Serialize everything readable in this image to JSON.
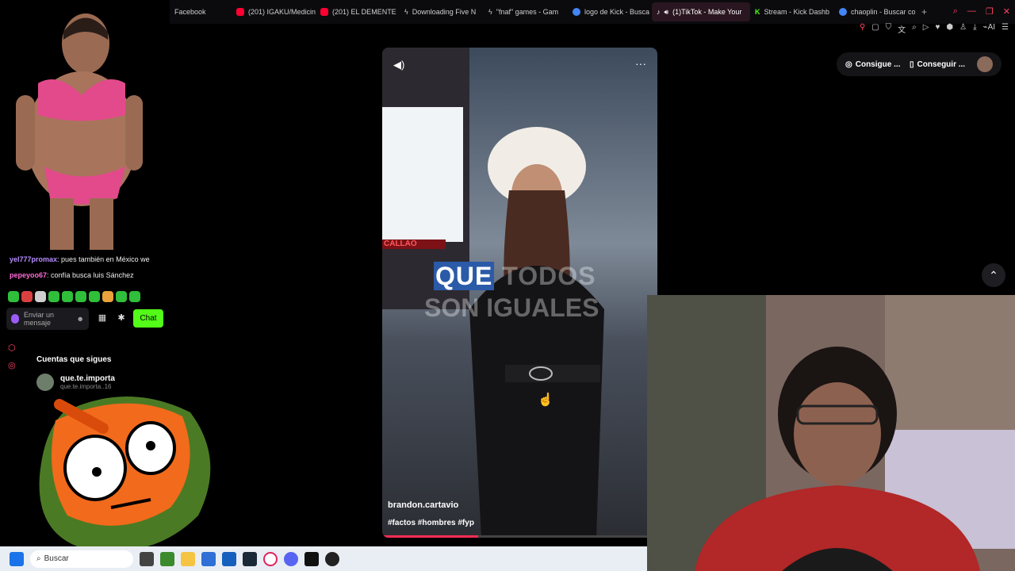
{
  "tabs": [
    {
      "label": "Facebook",
      "color": "#1877f2"
    },
    {
      "label": "(201) IGAKU/Medicin",
      "color": "#ff0033"
    },
    {
      "label": "(201) EL DEMENTE",
      "color": "#ff0033"
    },
    {
      "label": "Downloading Five N",
      "color": "#ffffff"
    },
    {
      "label": "\"fnaf\" games - Gam",
      "color": "#ffffff"
    },
    {
      "label": "logo de Kick - Busca",
      "color": "#4285f4"
    },
    {
      "label": "(1)TikTok - Make Your",
      "color": "#fe2c55",
      "active": true
    },
    {
      "label": "Stream - Kick Dashb",
      "color": "#53fc18"
    },
    {
      "label": "chaoplin - Buscar co",
      "color": "#4285f4"
    }
  ],
  "new_tab": "+",
  "window_controls": {
    "search": "⌕",
    "minimize": "—",
    "restore": "❐",
    "close": "✕"
  },
  "toolbar": {
    "ai_label": "AI"
  },
  "chat": {
    "messages": [
      {
        "user": "yel777promax",
        "text": ": pues también en México we",
        "user_color": "#b78cff"
      },
      {
        "user": "pepeyoo67",
        "text": ": confía busca luis Sánchez",
        "user_color": "#ff6bd6"
      }
    ],
    "input_placeholder_line1": "Enviar un",
    "input_placeholder_line2": "mensaje",
    "chat_button": "Chat"
  },
  "following": {
    "heading": "Cuentas que sigues",
    "items": [
      {
        "name": "que.te.importa",
        "sub": "que.te.importa..16"
      }
    ]
  },
  "video": {
    "caption_highlight": "QUE",
    "caption_rest": " TODOS",
    "caption_line2": "SON IGUALES",
    "sign": "CALLAO",
    "author": "brandon.cartavio",
    "tags": "#factos #hombres #fyp",
    "progress": 0.35
  },
  "buttons": {
    "get_coins": "Consigue ...",
    "get_app": "Conseguir ..."
  },
  "taskbar": {
    "search_label": "Buscar"
  },
  "colors": {
    "kick_green": "#53fc18",
    "tiktok_red": "#fe2c55"
  }
}
